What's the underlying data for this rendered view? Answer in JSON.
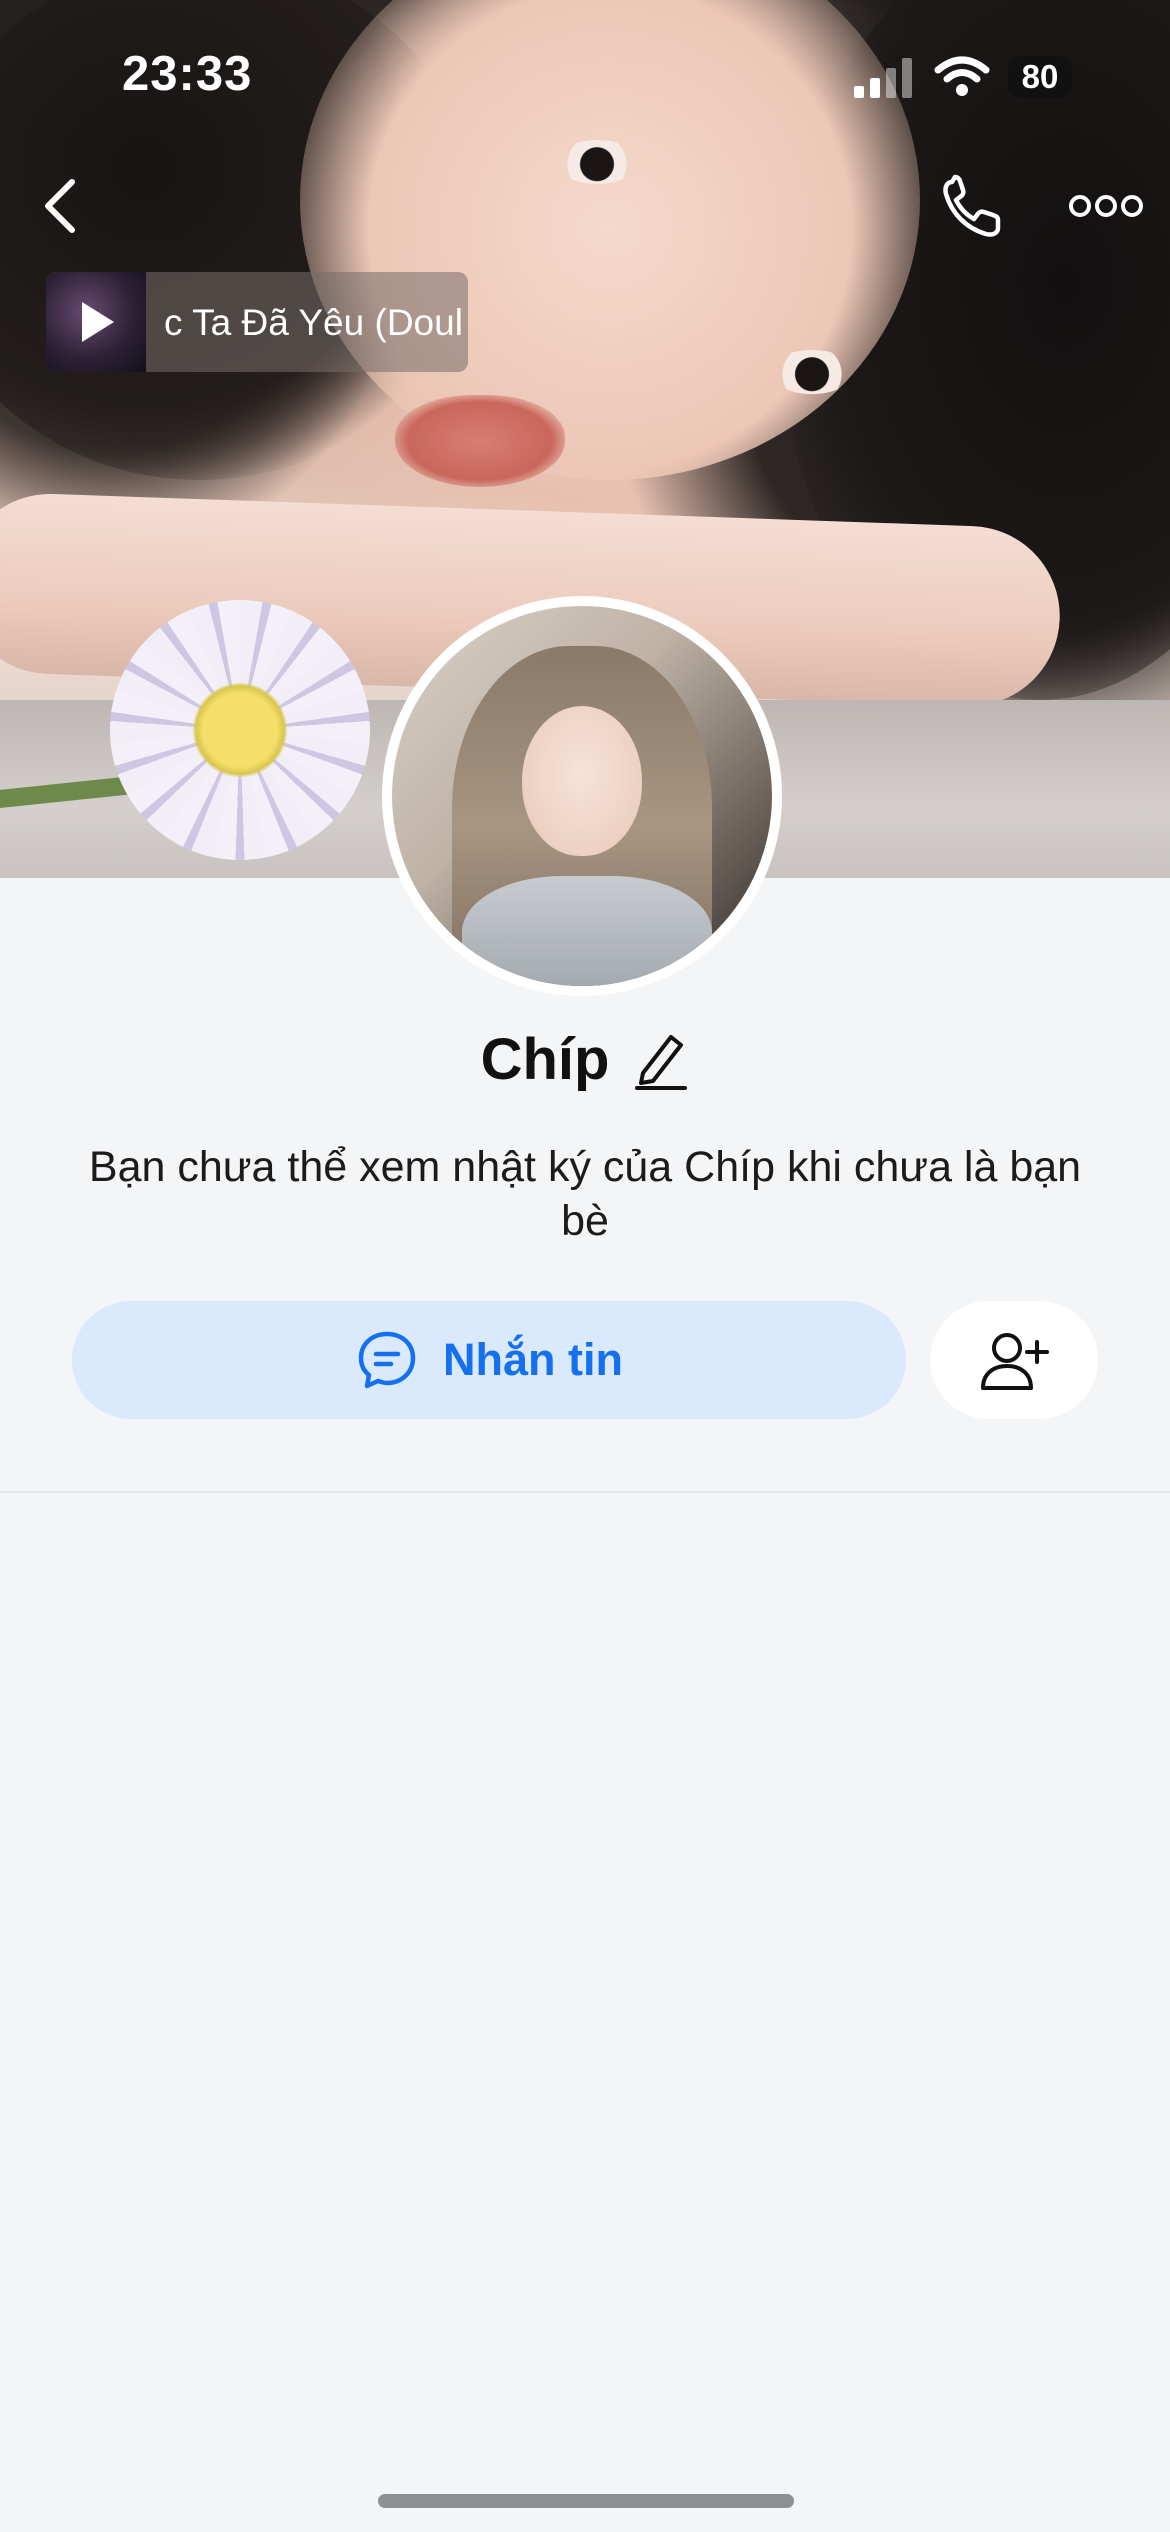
{
  "status_bar": {
    "time": "23:33",
    "battery": "80"
  },
  "nav": {
    "back_icon": "chevron-left-icon",
    "call_icon": "phone-icon",
    "more_icon": "more-horizontal-icon"
  },
  "music": {
    "title": "c Ta Đã Yêu (Doul",
    "play_icon": "play-icon"
  },
  "profile": {
    "name": "Chíp",
    "edit_icon": "pencil-icon",
    "note": "Bạn chưa thể xem nhật ký của Chíp khi chưa là bạn bè"
  },
  "actions": {
    "message_label": "Nhắn tin",
    "message_icon": "chat-bubble-icon",
    "add_friend_icon": "add-user-icon"
  },
  "colors": {
    "accent": "#1570ef",
    "message_button_bg": "#dbe9fd",
    "page_bg": "#f4f5f7"
  }
}
